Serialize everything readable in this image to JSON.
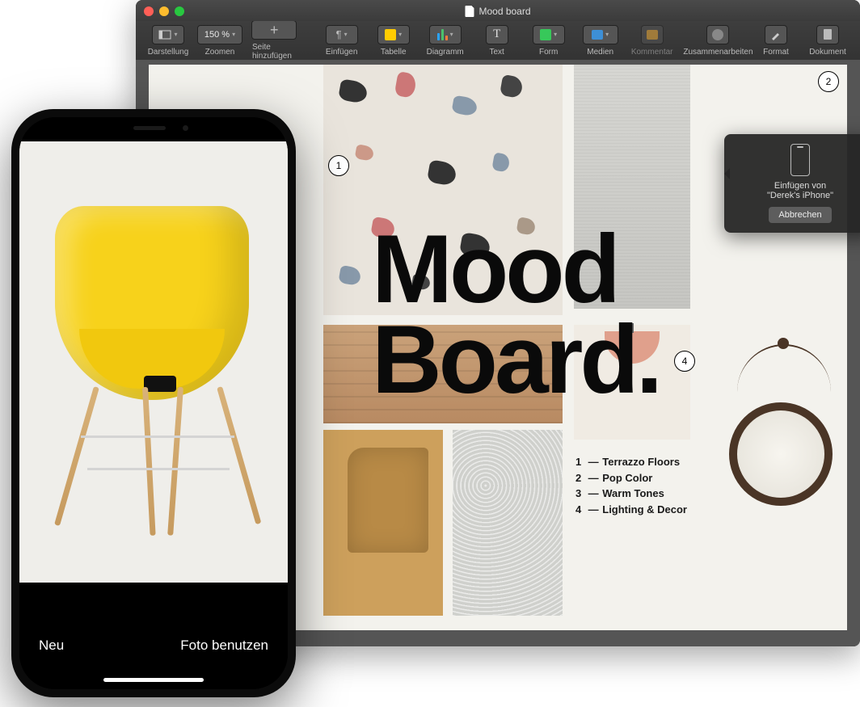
{
  "mac": {
    "title": "Mood board",
    "toolbar": {
      "view": "Darstellung",
      "zoom_label": "Zoomen",
      "zoom_value": "150 %",
      "add_page": "Seite hinzufügen",
      "insert": "Einfügen",
      "table": "Tabelle",
      "chart": "Diagramm",
      "text": "Text",
      "shape": "Form",
      "media": "Medien",
      "comment": "Kommentar",
      "collab": "Zusammenarbeiten",
      "format": "Format",
      "document": "Dokument"
    },
    "doc": {
      "heading": "Mood\nBoard.",
      "callouts": {
        "c1": "1",
        "c2": "2",
        "c4": "4"
      },
      "legend": [
        {
          "n": "1",
          "label": "Terrazzo Floors"
        },
        {
          "n": "2",
          "label": "Pop Color"
        },
        {
          "n": "3",
          "label": "Warm Tones"
        },
        {
          "n": "4",
          "label": "Lighting & Decor"
        }
      ]
    },
    "popover": {
      "text": "Einfügen von\n\"Derek's iPhone\"",
      "cancel": "Abbrechen"
    }
  },
  "iphone": {
    "retake": "Neu",
    "use": "Foto benutzen"
  }
}
